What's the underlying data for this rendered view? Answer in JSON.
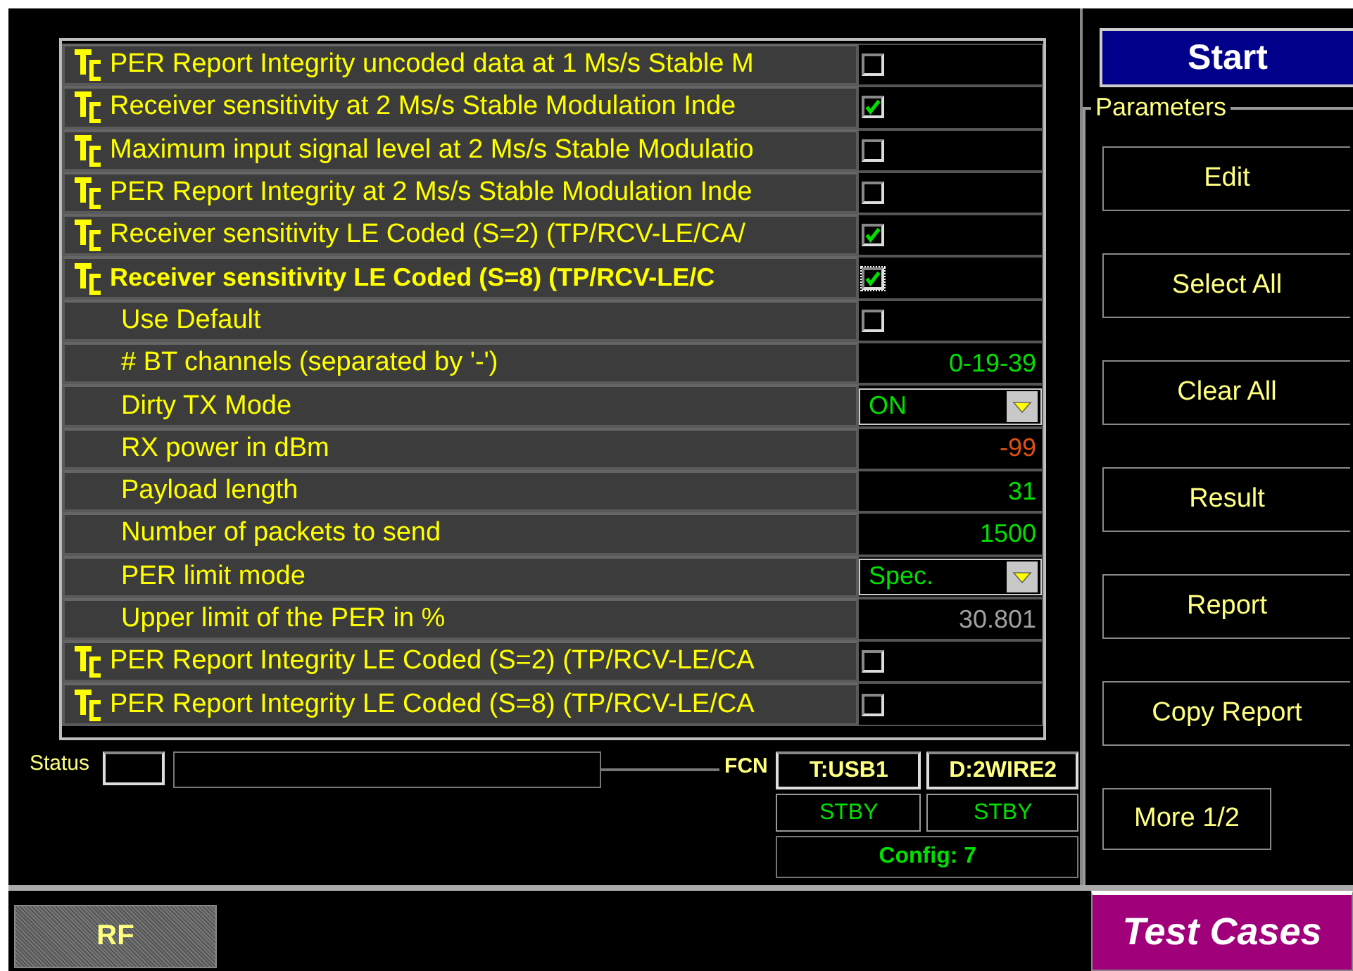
{
  "rows": [
    {
      "kind": "testcase",
      "label": "PER Report Integrity uncoded data at 1 Ms/s Stable M",
      "checked": false,
      "selected": false
    },
    {
      "kind": "testcase",
      "label": "Receiver sensitivity at 2 Ms/s Stable Modulation Inde",
      "checked": true,
      "selected": false
    },
    {
      "kind": "testcase",
      "label": "Maximum input signal level at 2 Ms/s Stable Modulatio",
      "checked": false,
      "selected": false
    },
    {
      "kind": "testcase",
      "label": "PER Report Integrity at 2 Ms/s Stable Modulation Inde",
      "checked": false,
      "selected": false
    },
    {
      "kind": "testcase",
      "label": "Receiver sensitivity LE Coded (S=2) (TP/RCV-LE/CA/",
      "checked": true,
      "selected": false
    },
    {
      "kind": "testcase",
      "label": "Receiver sensitivity LE Coded (S=8) (TP/RCV-LE/C",
      "checked": true,
      "selected": true
    },
    {
      "kind": "check",
      "label": "Use Default",
      "checked": false
    },
    {
      "kind": "text",
      "label": "# BT channels (separated by '-')",
      "value": "0-19-39",
      "color": "#00e000"
    },
    {
      "kind": "dropdown",
      "label": "Dirty TX Mode",
      "value": "ON"
    },
    {
      "kind": "text",
      "label": "RX power in dBm",
      "value": "-99",
      "color": "#e05010"
    },
    {
      "kind": "text",
      "label": "Payload length",
      "value": "31",
      "color": "#00e000"
    },
    {
      "kind": "text",
      "label": "Number of packets to send",
      "value": "1500",
      "color": "#00e000"
    },
    {
      "kind": "dropdown",
      "label": "PER limit mode",
      "value": "Spec."
    },
    {
      "kind": "text",
      "label": "Upper limit of the PER in %",
      "value": "30.801",
      "color": "#a0a0a0"
    },
    {
      "kind": "testcase",
      "label": "PER Report Integrity LE Coded (S=2) (TP/RCV-LE/CA",
      "checked": false,
      "selected": false
    },
    {
      "kind": "testcase",
      "label": "PER Report Integrity LE Coded (S=8) (TP/RCV-LE/CA",
      "checked": false,
      "selected": false
    }
  ],
  "status": {
    "label": "Status"
  },
  "fcn": {
    "label": "FCN",
    "ports": [
      {
        "name": "T:USB1",
        "state": "STBY"
      },
      {
        "name": "D:2WIRE2",
        "state": "STBY"
      }
    ],
    "config": "Config: 7"
  },
  "start_button": "Start",
  "parameters": {
    "title": "Parameters",
    "buttons": [
      "Edit",
      "Select All",
      "Clear All",
      "Result",
      "Report",
      "Copy Report"
    ],
    "more": "More 1/2"
  },
  "bottom_tabs": [
    {
      "label": "RF",
      "selected": false
    },
    {
      "label": "Test Cases",
      "selected": true
    }
  ]
}
